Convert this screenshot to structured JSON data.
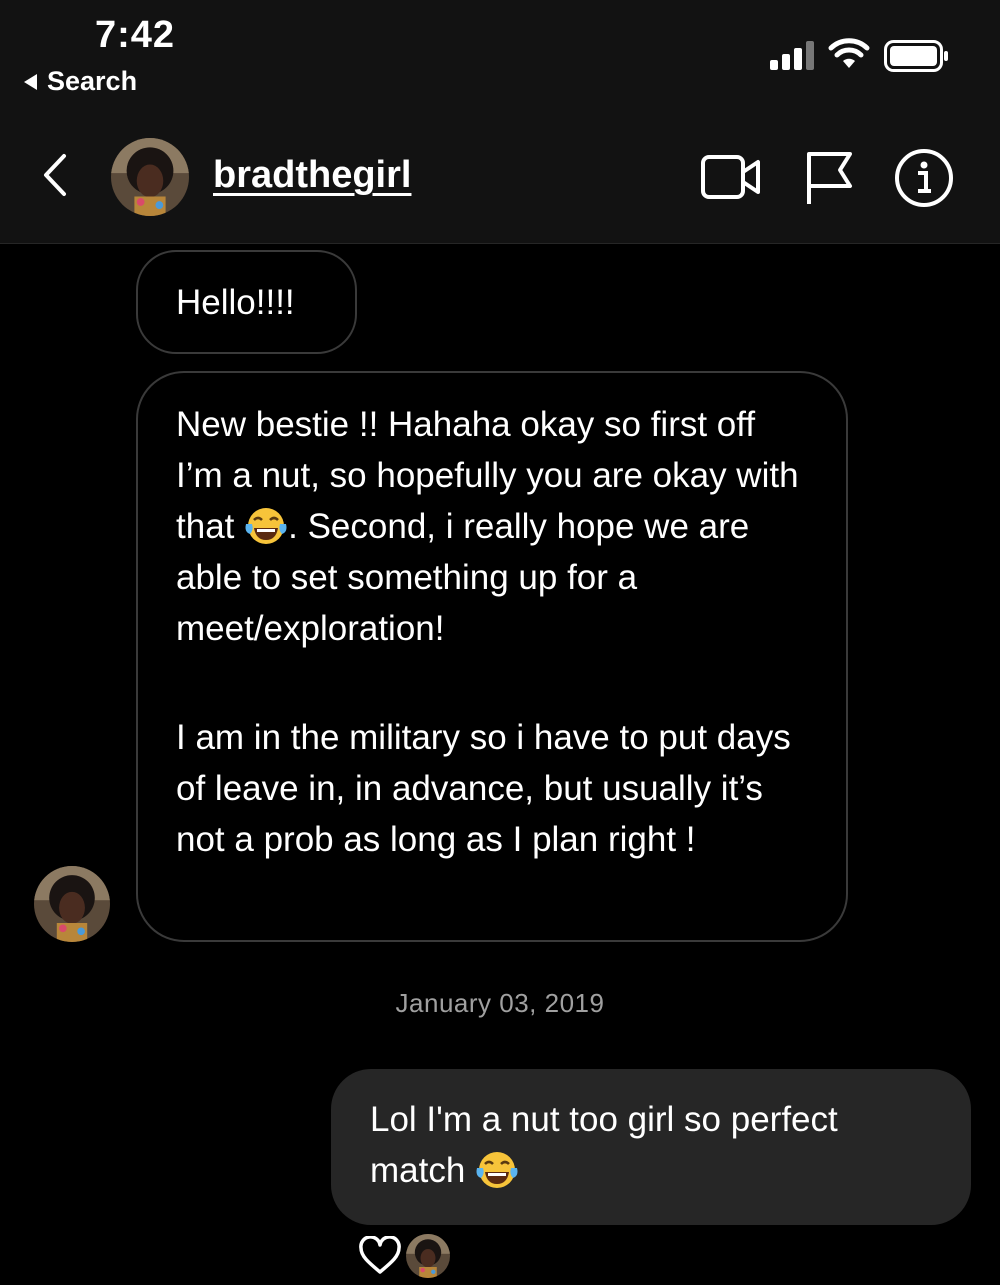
{
  "status_bar": {
    "time": "7:42",
    "back_app_label": "Search"
  },
  "header": {
    "username": "bradthegirl",
    "icons": [
      "chevron-left-icon",
      "video-camera-icon",
      "flag-icon",
      "info-icon"
    ]
  },
  "messages": [
    {
      "direction": "incoming",
      "text": "Hello!!!!"
    },
    {
      "direction": "incoming",
      "paragraph1_part1": "New bestie !! Hahaha okay so first off I’m a nut, so hopefully you are okay with that",
      "emoji1": "face-with-tears-of-joy",
      "paragraph1_part2": ". Second, i really hope we are able to set something up for a meet/exploration!",
      "paragraph2": "I am in the military so i have to put days of leave in, in advance, but usually it’s not a prob as long as I plan right !"
    },
    {
      "direction": "outgoing",
      "text": "Lol I'm a nut too girl so perfect match",
      "emoji": "face-with-tears-of-joy"
    }
  ],
  "date_separator": "January 03, 2019",
  "reaction": {
    "icon": "heart-icon",
    "by": "bradthegirl"
  }
}
